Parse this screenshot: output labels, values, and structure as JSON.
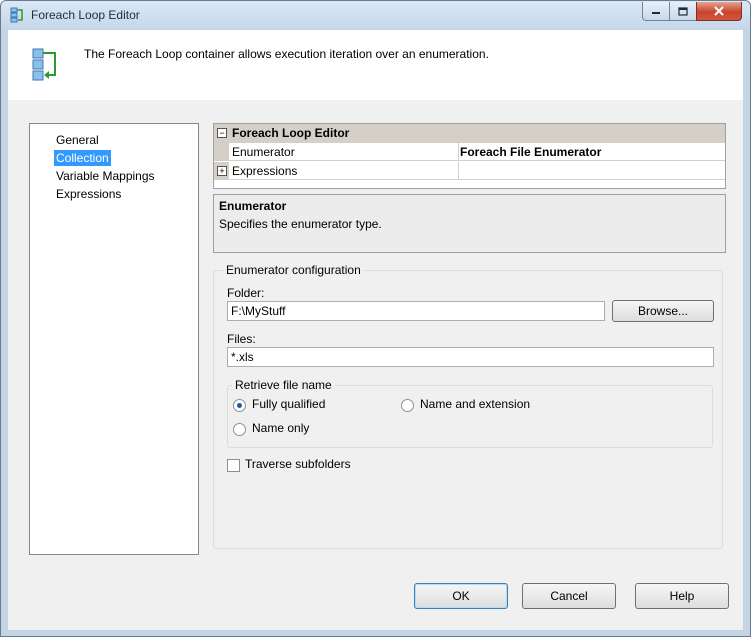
{
  "window": {
    "title": "Foreach Loop Editor"
  },
  "header": {
    "description": "The Foreach Loop container allows execution iteration over an enumeration."
  },
  "nav": {
    "items": [
      {
        "label": "General"
      },
      {
        "label": "Collection"
      },
      {
        "label": "Variable Mappings"
      },
      {
        "label": "Expressions"
      }
    ],
    "selected": "Collection"
  },
  "property_grid": {
    "category": "Foreach Loop Editor",
    "rows": [
      {
        "name": "Enumerator",
        "value": "Foreach File Enumerator"
      },
      {
        "name": "Expressions",
        "value": ""
      }
    ]
  },
  "help": {
    "title": "Enumerator",
    "description": "Specifies the enumerator type."
  },
  "config": {
    "legend": "Enumerator configuration",
    "folder_label": "Folder:",
    "folder_value": "F:\\MyStuff",
    "browse_label": "Browse...",
    "files_label": "Files:",
    "files_value": "*.xls",
    "retrieve": {
      "legend": "Retrieve file name",
      "options": [
        {
          "label": "Fully qualified",
          "selected": true
        },
        {
          "label": "Name and extension",
          "selected": false
        },
        {
          "label": "Name only",
          "selected": false
        }
      ]
    },
    "traverse_label": "Traverse subfolders",
    "traverse_checked": false
  },
  "buttons": {
    "ok": "OK",
    "cancel": "Cancel",
    "help": "Help"
  },
  "colors": {
    "selection": "#3399ff",
    "title_bar": "#c6d7ea",
    "close_button": "#c8452d"
  }
}
